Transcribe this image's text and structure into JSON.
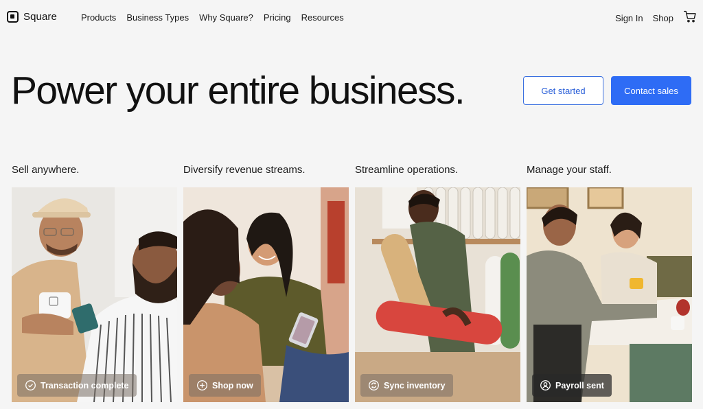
{
  "brand": {
    "name": "Square"
  },
  "nav": {
    "links": [
      "Products",
      "Business Types",
      "Why Square?",
      "Pricing",
      "Resources"
    ],
    "sign_in": "Sign In",
    "shop": "Shop"
  },
  "hero": {
    "title": "Power your entire business.",
    "get_started": "Get started",
    "contact_sales": "Contact sales"
  },
  "cards": [
    {
      "title": "Sell anywhere.",
      "badge": "Transaction complete",
      "badge_icon": "check-circle-icon"
    },
    {
      "title": "Diversify revenue streams.",
      "badge": "Shop now",
      "badge_icon": "plus-circle-icon"
    },
    {
      "title": "Streamline operations.",
      "badge": "Sync inventory",
      "badge_icon": "sync-icon"
    },
    {
      "title": "Manage your staff.",
      "badge": "Payroll sent",
      "badge_icon": "person-circle-icon"
    }
  ],
  "colors": {
    "accent": "#2e6cf5",
    "background": "#f5f5f5",
    "text": "#1a1a1a"
  }
}
